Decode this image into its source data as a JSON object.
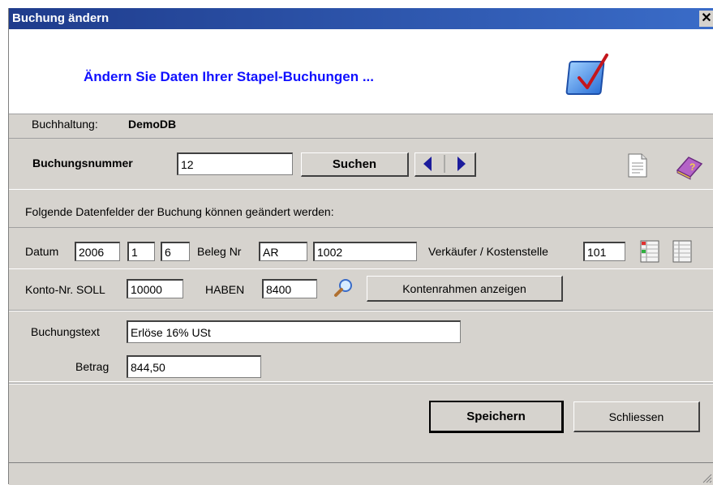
{
  "window": {
    "title": "Buchung ändern",
    "close_glyph": "✕"
  },
  "banner": {
    "headline": "Ändern Sie Daten Ihrer Stapel-Buchungen ...",
    "icon": "checkbox-check-icon"
  },
  "buchhaltung": {
    "label": "Buchhaltung:",
    "value": "DemoDB"
  },
  "search": {
    "label": "Buchungsnummer",
    "value": "12",
    "button": "Suchen",
    "prev_icon": "triangle-left-icon",
    "next_icon": "triangle-right-icon",
    "doc_icon": "document-icon",
    "help_icon": "help-book-icon"
  },
  "info_text": "Folgende Datenfelder der Buchung können geändert werden:",
  "datum": {
    "label": "Datum",
    "year": "2006",
    "month": "1",
    "day": "6"
  },
  "beleg": {
    "label": "Beleg Nr",
    "prefix": "AR",
    "number": "1002"
  },
  "verkaeufer": {
    "label": "Verkäufer / Kostenstelle",
    "value": "101"
  },
  "konto": {
    "soll_label": "Konto-Nr. SOLL",
    "soll_value": "10000",
    "haben_label": "HABEN",
    "haben_value": "8400",
    "button": "Kontenrahmen anzeigen"
  },
  "buchungstext": {
    "label": "Buchungstext",
    "value": "Erlöse 16% USt"
  },
  "betrag": {
    "label": "Betrag",
    "value": "844,50"
  },
  "actions": {
    "save": "Speichern",
    "close": "Schliessen"
  }
}
